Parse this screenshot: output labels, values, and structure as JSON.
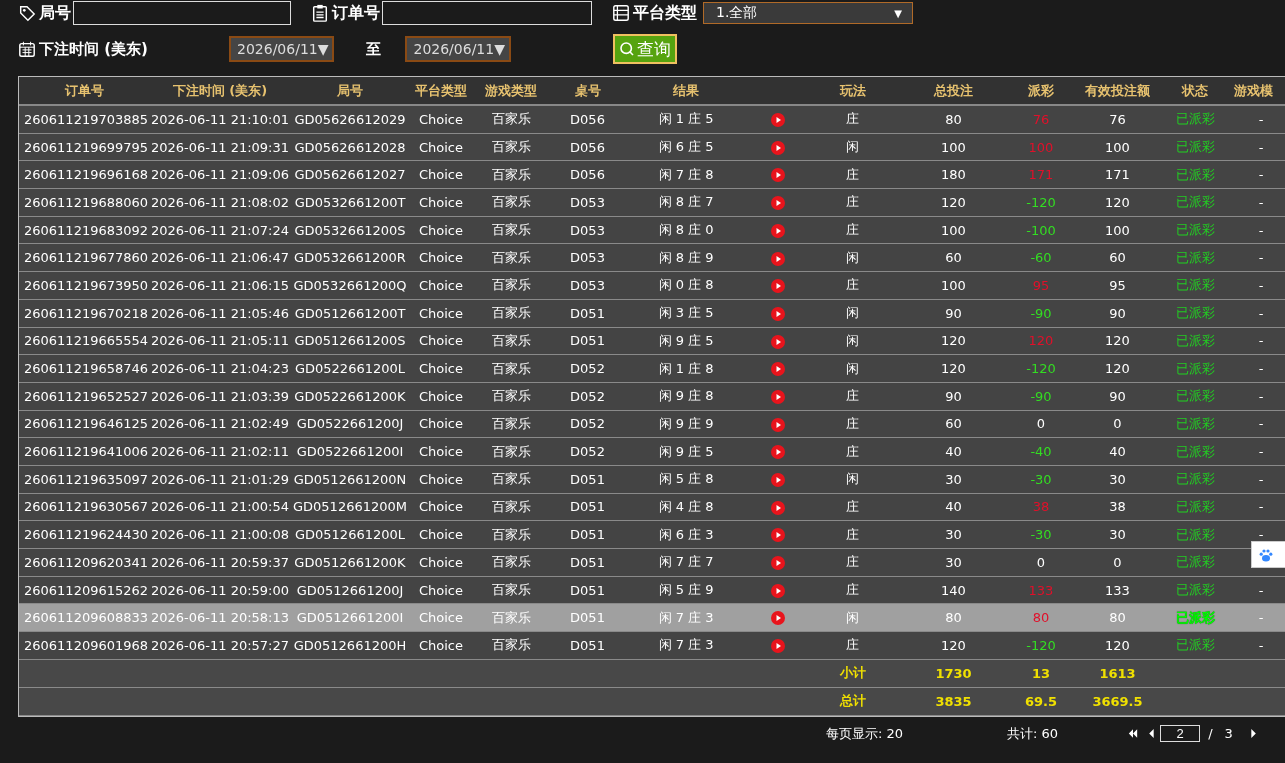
{
  "filters": {
    "round_label": "局号",
    "order_label": "订单号",
    "platform_label": "平台类型",
    "platform_value": "1.全部",
    "platform_caret": "▼",
    "time_label": "下注时间 (美东)",
    "date_from": "2026/06/11▼",
    "to_label": "至",
    "date_to": "2026/06/11▼",
    "query_button": "查询"
  },
  "table": {
    "columns": [
      "订单号",
      "下注时间 (美东)",
      "局号",
      "平台类型",
      "游戏类型",
      "桌号",
      "结果",
      "",
      "玩法",
      "总投注",
      "派彩",
      "有效投注额",
      "状态",
      "游戏模"
    ],
    "rows": [
      {
        "order": "260611219703885",
        "time": "2026-06-11 21:10:01",
        "round": "GD05626612029",
        "platform": "Choice",
        "game": "百家乐",
        "desk": "D056",
        "result": "闲 1 庄 5",
        "play": "庄",
        "bet": "80",
        "payout": "76",
        "color": "#e0102a",
        "valid": "76",
        "status": "已派彩",
        "mode": "-",
        "selected": false
      },
      {
        "order": "260611219699795",
        "time": "2026-06-11 21:09:31",
        "round": "GD05626612028",
        "platform": "Choice",
        "game": "百家乐",
        "desk": "D056",
        "result": "闲 6 庄 5",
        "play": "闲",
        "bet": "100",
        "payout": "100",
        "color": "#e0102a",
        "valid": "100",
        "status": "已派彩",
        "mode": "-",
        "selected": false
      },
      {
        "order": "260611219696168",
        "time": "2026-06-11 21:09:06",
        "round": "GD05626612027",
        "platform": "Choice",
        "game": "百家乐",
        "desk": "D056",
        "result": "闲 7 庄 8",
        "play": "庄",
        "bet": "180",
        "payout": "171",
        "color": "#e0102a",
        "valid": "171",
        "status": "已派彩",
        "mode": "-",
        "selected": false
      },
      {
        "order": "260611219688060",
        "time": "2026-06-11 21:08:02",
        "round": "GD0532661200T",
        "platform": "Choice",
        "game": "百家乐",
        "desk": "D053",
        "result": "闲 8 庄 7",
        "play": "庄",
        "bet": "120",
        "payout": "-120",
        "color": "#33dd22",
        "valid": "120",
        "status": "已派彩",
        "mode": "-",
        "selected": false
      },
      {
        "order": "260611219683092",
        "time": "2026-06-11 21:07:24",
        "round": "GD0532661200S",
        "platform": "Choice",
        "game": "百家乐",
        "desk": "D053",
        "result": "闲 8 庄 0",
        "play": "庄",
        "bet": "100",
        "payout": "-100",
        "color": "#33dd22",
        "valid": "100",
        "status": "已派彩",
        "mode": "-",
        "selected": false
      },
      {
        "order": "260611219677860",
        "time": "2026-06-11 21:06:47",
        "round": "GD0532661200R",
        "platform": "Choice",
        "game": "百家乐",
        "desk": "D053",
        "result": "闲 8 庄 9",
        "play": "闲",
        "bet": "60",
        "payout": "-60",
        "color": "#33dd22",
        "valid": "60",
        "status": "已派彩",
        "mode": "-",
        "selected": false
      },
      {
        "order": "260611219673950",
        "time": "2026-06-11 21:06:15",
        "round": "GD0532661200Q",
        "platform": "Choice",
        "game": "百家乐",
        "desk": "D053",
        "result": "闲 0 庄 8",
        "play": "庄",
        "bet": "100",
        "payout": "95",
        "color": "#e0102a",
        "valid": "95",
        "status": "已派彩",
        "mode": "-",
        "selected": false
      },
      {
        "order": "260611219670218",
        "time": "2026-06-11 21:05:46",
        "round": "GD0512661200T",
        "platform": "Choice",
        "game": "百家乐",
        "desk": "D051",
        "result": "闲 3 庄 5",
        "play": "闲",
        "bet": "90",
        "payout": "-90",
        "color": "#33dd22",
        "valid": "90",
        "status": "已派彩",
        "mode": "-",
        "selected": false
      },
      {
        "order": "260611219665554",
        "time": "2026-06-11 21:05:11",
        "round": "GD0512661200S",
        "platform": "Choice",
        "game": "百家乐",
        "desk": "D051",
        "result": "闲 9 庄 5",
        "play": "闲",
        "bet": "120",
        "payout": "120",
        "color": "#e0102a",
        "valid": "120",
        "status": "已派彩",
        "mode": "-",
        "selected": false
      },
      {
        "order": "260611219658746",
        "time": "2026-06-11 21:04:23",
        "round": "GD0522661200L",
        "platform": "Choice",
        "game": "百家乐",
        "desk": "D052",
        "result": "闲 1 庄 8",
        "play": "闲",
        "bet": "120",
        "payout": "-120",
        "color": "#33dd22",
        "valid": "120",
        "status": "已派彩",
        "mode": "-",
        "selected": false
      },
      {
        "order": "260611219652527",
        "time": "2026-06-11 21:03:39",
        "round": "GD0522661200K",
        "platform": "Choice",
        "game": "百家乐",
        "desk": "D052",
        "result": "闲 9 庄 8",
        "play": "庄",
        "bet": "90",
        "payout": "-90",
        "color": "#33dd22",
        "valid": "90",
        "status": "已派彩",
        "mode": "-",
        "selected": false
      },
      {
        "order": "260611219646125",
        "time": "2026-06-11 21:02:49",
        "round": "GD0522661200J",
        "platform": "Choice",
        "game": "百家乐",
        "desk": "D052",
        "result": "闲 9 庄 9",
        "play": "庄",
        "bet": "60",
        "payout": "0",
        "color": "#ffffff",
        "valid": "0",
        "status": "已派彩",
        "mode": "-",
        "selected": false
      },
      {
        "order": "260611219641006",
        "time": "2026-06-11 21:02:11",
        "round": "GD0522661200I",
        "platform": "Choice",
        "game": "百家乐",
        "desk": "D052",
        "result": "闲 9 庄 5",
        "play": "庄",
        "bet": "40",
        "payout": "-40",
        "color": "#33dd22",
        "valid": "40",
        "status": "已派彩",
        "mode": "-",
        "selected": false
      },
      {
        "order": "260611219635097",
        "time": "2026-06-11 21:01:29",
        "round": "GD0512661200N",
        "platform": "Choice",
        "game": "百家乐",
        "desk": "D051",
        "result": "闲 5 庄 8",
        "play": "闲",
        "bet": "30",
        "payout": "-30",
        "color": "#33dd22",
        "valid": "30",
        "status": "已派彩",
        "mode": "-",
        "selected": false
      },
      {
        "order": "260611219630567",
        "time": "2026-06-11 21:00:54",
        "round": "GD0512661200M",
        "platform": "Choice",
        "game": "百家乐",
        "desk": "D051",
        "result": "闲 4 庄 8",
        "play": "庄",
        "bet": "40",
        "payout": "38",
        "color": "#e0102a",
        "valid": "38",
        "status": "已派彩",
        "mode": "-",
        "selected": false
      },
      {
        "order": "260611219624430",
        "time": "2026-06-11 21:00:08",
        "round": "GD0512661200L",
        "platform": "Choice",
        "game": "百家乐",
        "desk": "D051",
        "result": "闲 6 庄 3",
        "play": "庄",
        "bet": "30",
        "payout": "-30",
        "color": "#33dd22",
        "valid": "30",
        "status": "已派彩",
        "mode": "-",
        "selected": false
      },
      {
        "order": "260611209620341",
        "time": "2026-06-11 20:59:37",
        "round": "GD0512661200K",
        "platform": "Choice",
        "game": "百家乐",
        "desk": "D051",
        "result": "闲 7 庄 7",
        "play": "庄",
        "bet": "30",
        "payout": "0",
        "color": "#ffffff",
        "valid": "0",
        "status": "已派彩",
        "selected": false
      },
      {
        "order": "260611209615262",
        "time": "2026-06-11 20:59:00",
        "round": "GD0512661200J",
        "platform": "Choice",
        "game": "百家乐",
        "desk": "D051",
        "result": "闲 5 庄 9",
        "play": "庄",
        "bet": "140",
        "payout": "133",
        "color": "#e0102a",
        "valid": "133",
        "status": "已派彩",
        "mode": "-",
        "selected": false
      },
      {
        "order": "260611209608833",
        "time": "2026-06-11 20:58:13",
        "round": "GD0512661200I",
        "platform": "Choice",
        "game": "百家乐",
        "desk": "D051",
        "result": "闲 7 庄 3",
        "play": "闲",
        "bet": "80",
        "payout": "80",
        "color": "#e0102a",
        "valid": "80",
        "status": "已派彩",
        "mode": "-",
        "selected": true
      },
      {
        "order": "260611209601968",
        "time": "2026-06-11 20:57:27",
        "round": "GD0512661200H",
        "platform": "Choice",
        "game": "百家乐",
        "desk": "D051",
        "result": "闲 7 庄 3",
        "play": "庄",
        "bet": "120",
        "payout": "-120",
        "color": "#33dd22",
        "valid": "120",
        "status": "已派彩",
        "mode": "-",
        "selected": false
      }
    ],
    "totals": [
      {
        "label": "小计",
        "bet": "1730",
        "payout": "13",
        "valid": "1613"
      },
      {
        "label": "总计",
        "bet": "3835",
        "payout": "69.5",
        "valid": "3669.5"
      }
    ]
  },
  "pager": {
    "per_page": "每页显示: 20",
    "total": "共计: 60",
    "page": "2",
    "separator": "/",
    "pages": "3"
  }
}
